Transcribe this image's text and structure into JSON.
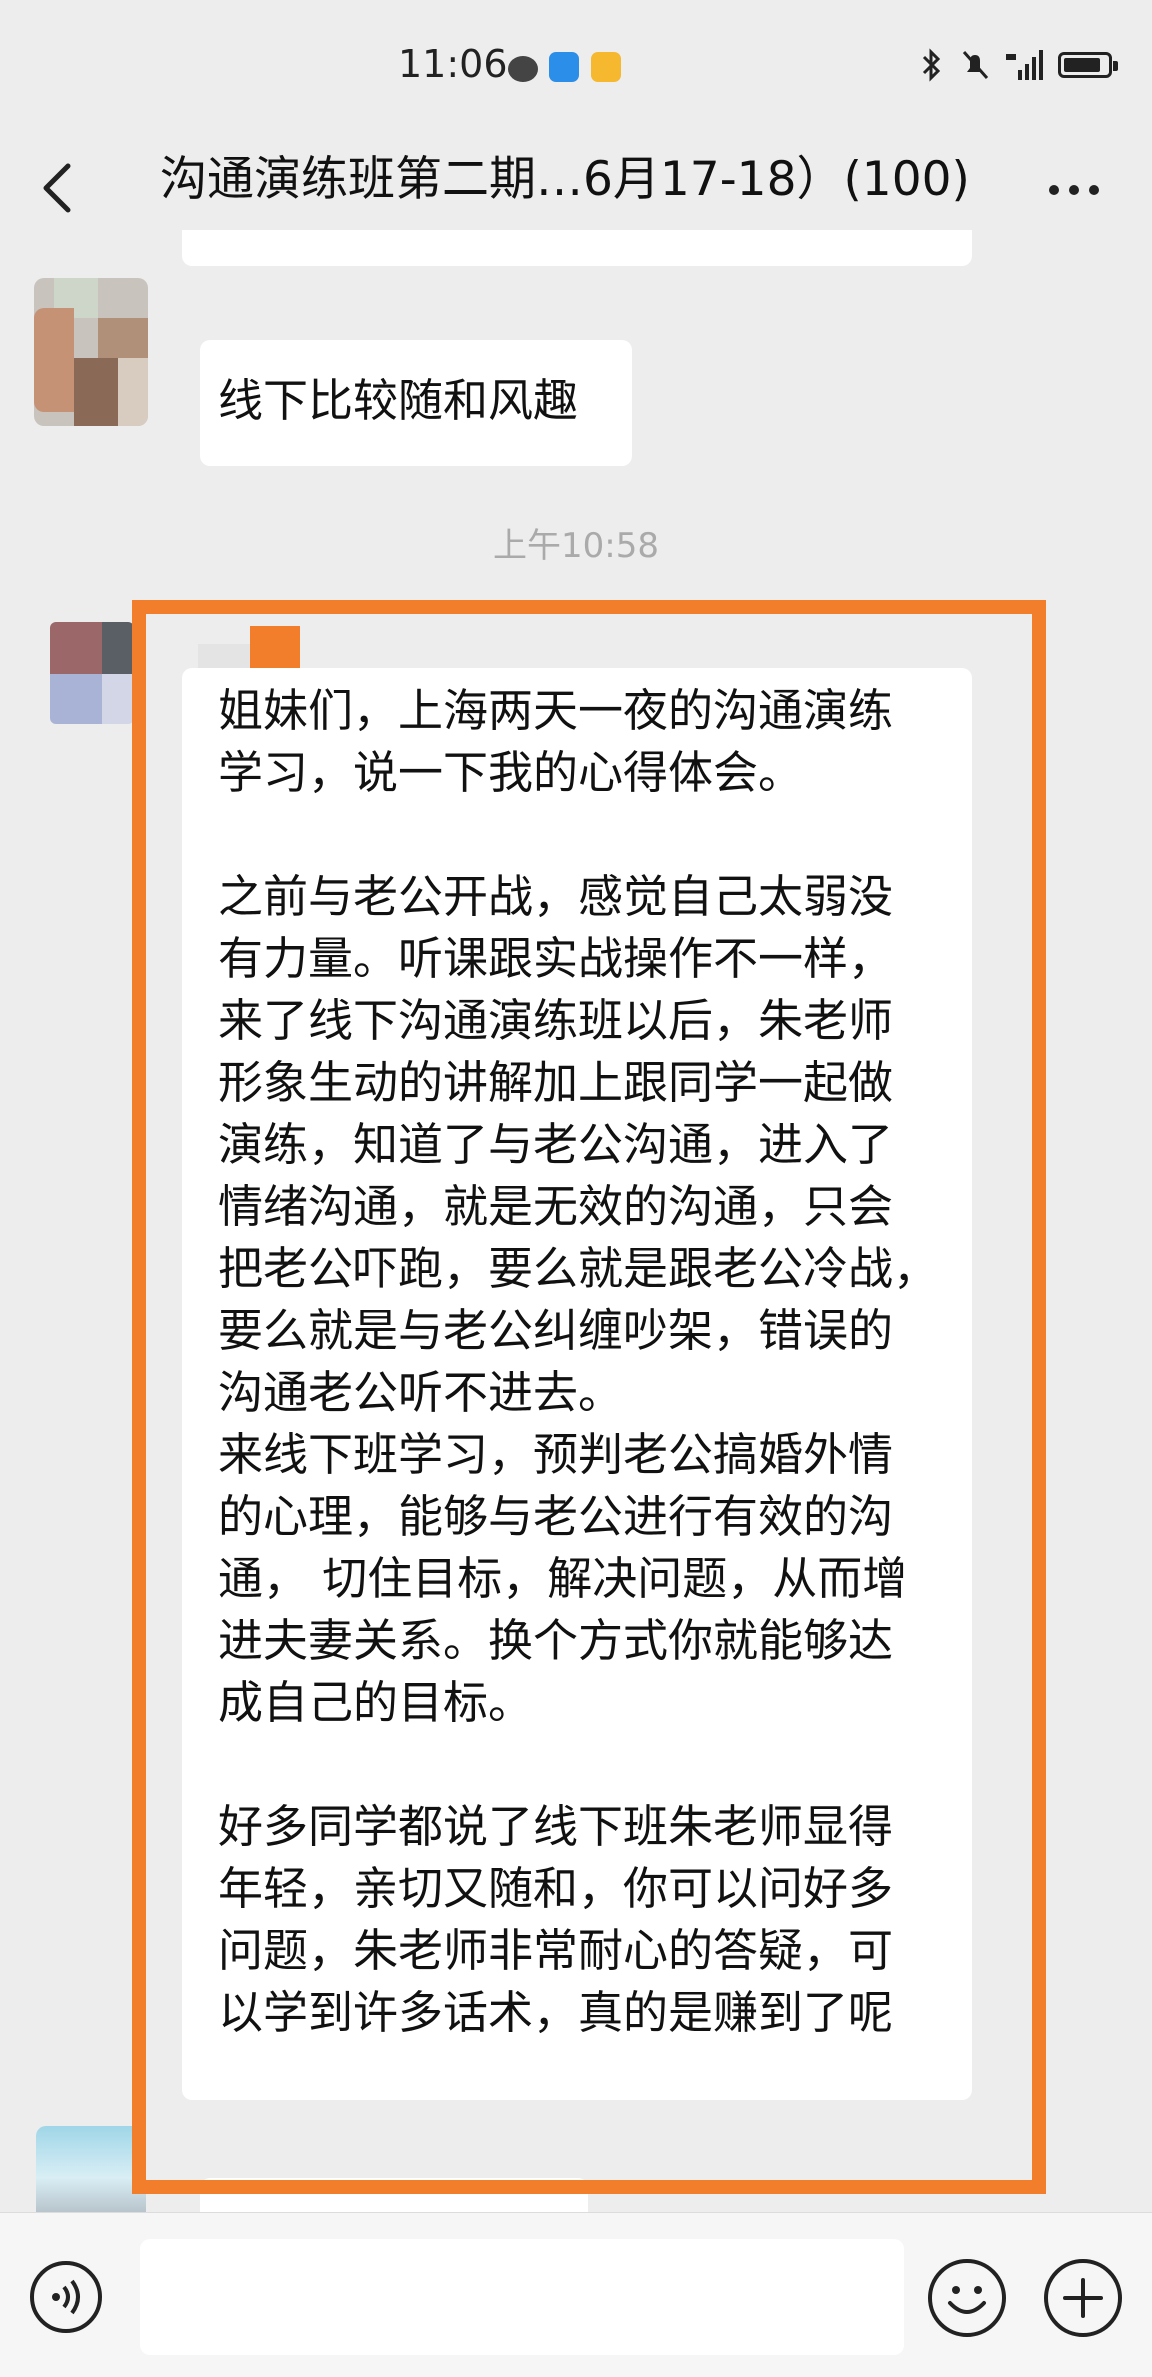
{
  "status_bar": {
    "time": "11:06",
    "icons": [
      "wechat-icon",
      "bird-icon",
      "note-icon",
      "bluetooth-icon",
      "mute-icon",
      "signal-4g-icon",
      "battery-icon"
    ]
  },
  "nav": {
    "title": "沟通演练班第二期…6月17-18）(100)"
  },
  "messages": [
    {
      "text": "线下比较随和风趣"
    }
  ],
  "timestamp": "上午10:58",
  "highlighted_message": {
    "paragraphs": [
      [
        "姐妹们，上海两天一夜的沟通演练",
        "学习，说一下我的心得体会。"
      ],
      [
        "之前与老公开战，感觉自己太弱没",
        "有力量。听课跟实战操作不一样，",
        "来了线下沟通演练班以后，朱老师",
        "形象生动的讲解加上跟同学一起做",
        "演练，知道了与老公沟通，进入了",
        "情绪沟通，就是无效的沟通，只会",
        "把老公吓跑，要么就是跟老公冷战，",
        "要么就是与老公纠缠吵架，错误的",
        "沟通老公听不进去。",
        "来线下班学习，预判老公搞婚外情",
        "的心理，能够与老公进行有效的沟",
        "通， 切住目标，解决问题，从而增",
        "进夫妻关系。换个方式你就能够达",
        "成自己的目标。"
      ],
      [
        "好多同学都说了线下班朱老师显得",
        "年轻，亲切又随和，你可以问好多",
        "问题，朱老师非常耐心的答疑，可",
        "以学到许多话术，真的是赚到了呢"
      ]
    ]
  },
  "colors": {
    "background": "#ededed",
    "bubble": "#ffffff",
    "highlight": "#f27d2b"
  }
}
